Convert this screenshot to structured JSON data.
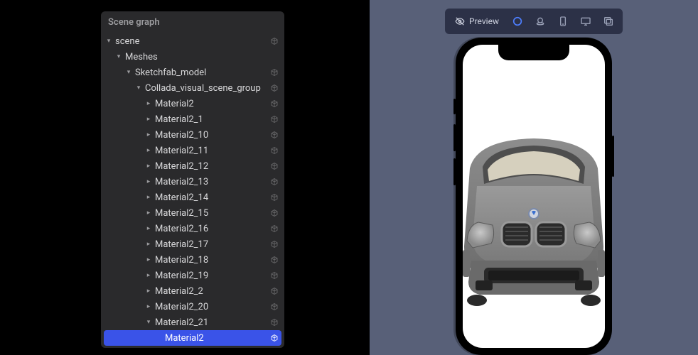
{
  "panel": {
    "title": "Scene graph",
    "tree": [
      {
        "label": "scene",
        "depth": 0,
        "chev": "down",
        "icon": true
      },
      {
        "label": "Meshes",
        "depth": 1,
        "chev": "down",
        "icon": false
      },
      {
        "label": "Sketchfab_model",
        "depth": 2,
        "chev": "down",
        "icon": true
      },
      {
        "label": "Collada_visual_scene_group",
        "depth": 3,
        "chev": "down",
        "icon": true
      },
      {
        "label": "Material2",
        "depth": 4,
        "chev": "right",
        "icon": true
      },
      {
        "label": "Material2_1",
        "depth": 4,
        "chev": "right",
        "icon": true
      },
      {
        "label": "Material2_10",
        "depth": 4,
        "chev": "right",
        "icon": true
      },
      {
        "label": "Material2_11",
        "depth": 4,
        "chev": "right",
        "icon": true
      },
      {
        "label": "Material2_12",
        "depth": 4,
        "chev": "right",
        "icon": true
      },
      {
        "label": "Material2_13",
        "depth": 4,
        "chev": "right",
        "icon": true
      },
      {
        "label": "Material2_14",
        "depth": 4,
        "chev": "right",
        "icon": true
      },
      {
        "label": "Material2_15",
        "depth": 4,
        "chev": "right",
        "icon": true
      },
      {
        "label": "Material2_16",
        "depth": 4,
        "chev": "right",
        "icon": true
      },
      {
        "label": "Material2_17",
        "depth": 4,
        "chev": "right",
        "icon": true
      },
      {
        "label": "Material2_18",
        "depth": 4,
        "chev": "right",
        "icon": true
      },
      {
        "label": "Material2_19",
        "depth": 4,
        "chev": "right",
        "icon": true
      },
      {
        "label": "Material2_2",
        "depth": 4,
        "chev": "right",
        "icon": true
      },
      {
        "label": "Material2_20",
        "depth": 4,
        "chev": "right",
        "icon": true
      },
      {
        "label": "Material2_21",
        "depth": 4,
        "chev": "down",
        "icon": true
      },
      {
        "label": "Material2",
        "depth": 5,
        "chev": "none",
        "icon": true,
        "selected": true
      }
    ]
  },
  "preview": {
    "label": "Preview",
    "toolbar": [
      "eye",
      "circle",
      "coins",
      "portrait",
      "desktop",
      "multi"
    ],
    "active_index": 1
  },
  "colors": {
    "car_body": "#7a7a7a",
    "car_dark": "#4a4a4a",
    "accent": "#3a53e8"
  }
}
